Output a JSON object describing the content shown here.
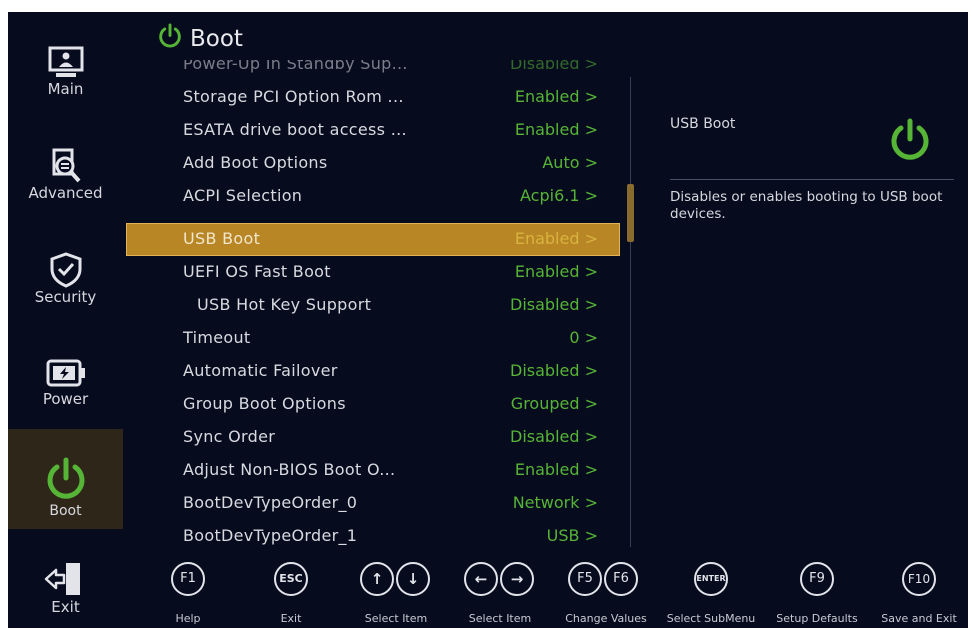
{
  "header": {
    "title": "Boot"
  },
  "sidebar": {
    "items": [
      {
        "label": "Main",
        "icon": "monitor-icon"
      },
      {
        "label": "Advanced",
        "icon": "magnifier-icon"
      },
      {
        "label": "Security",
        "icon": "shield-icon"
      },
      {
        "label": "Power",
        "icon": "battery-icon"
      },
      {
        "label": "Boot",
        "icon": "power-icon",
        "active": true
      },
      {
        "label": "Exit",
        "icon": "exit-door-icon"
      }
    ]
  },
  "settings": [
    {
      "label": "Power-Up In Standby Sup...",
      "value": "Disabled >",
      "partial": true
    },
    {
      "label": "Storage PCI Option Rom ...",
      "value": "Enabled >"
    },
    {
      "label": "ESATA drive boot access ...",
      "value": "Enabled >"
    },
    {
      "label": "Add Boot Options",
      "value": "Auto >"
    },
    {
      "label": "ACPI Selection",
      "value": "Acpi6.1 >"
    },
    {
      "label": "USB Boot",
      "value": "Enabled >",
      "selected": true
    },
    {
      "label": "UEFI OS Fast Boot",
      "value": "Enabled >"
    },
    {
      "label": "USB Hot Key Support",
      "value": "Disabled >",
      "indent": true
    },
    {
      "label": "Timeout",
      "value": "0 >"
    },
    {
      "label": "Automatic Failover",
      "value": "Disabled >"
    },
    {
      "label": "Group Boot Options",
      "value": "Grouped >"
    },
    {
      "label": "Sync Order",
      "value": "Disabled >"
    },
    {
      "label": "Adjust Non-BIOS Boot O...",
      "value": "Enabled >"
    },
    {
      "label": "BootDevTypeOrder_0",
      "value": "Network >"
    },
    {
      "label": "BootDevTypeOrder_1",
      "value": "USB >"
    }
  ],
  "help": {
    "title": "USB Boot",
    "description": "Disables or enables booting to USB boot devices."
  },
  "footer": {
    "keys": [
      {
        "keys": [
          "F1"
        ],
        "label": "Help"
      },
      {
        "keys": [
          "ESC"
        ],
        "label": "Exit"
      },
      {
        "keys": [
          "↑",
          "↓"
        ],
        "label": "Select Item"
      },
      {
        "keys": [
          "←",
          "→"
        ],
        "label": "Select Item"
      },
      {
        "keys": [
          "F5",
          "F6"
        ],
        "label": "Change Values"
      },
      {
        "keys": [
          "ENTER"
        ],
        "label": "Select SubMenu"
      },
      {
        "keys": [
          "F9"
        ],
        "label": "Setup Defaults"
      },
      {
        "keys": [
          "F10"
        ],
        "label": "Save and Exit"
      }
    ]
  },
  "colors": {
    "value_green": "#56b436",
    "highlight": "#b88624",
    "background": "#070b1e",
    "boot_active_bg": "#2e2618"
  }
}
